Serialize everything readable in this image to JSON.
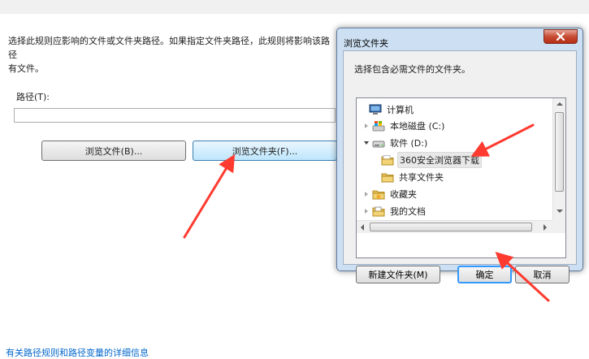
{
  "background_panel": {
    "description": "选择此规则应影响的文件或文件夹路径。如果指定文件夹路径，此规则将影响该路径\n有文件。",
    "path_label": "路径(T):",
    "path_value": "",
    "browse_file_label": "浏览文件(B)...",
    "browse_folder_label": "浏览文件夹(F)...",
    "help_link": "有关路径规则和路径变量的详细信息"
  },
  "dialog": {
    "title": "浏览文件夹",
    "prompt": "选择包含必需文件的文件夹。",
    "close_icon": "close-x-icon",
    "tree": [
      {
        "label": "计算机",
        "icon": "computer-icon",
        "expander": "none",
        "level": 0
      },
      {
        "label": "本地磁盘 (C:)",
        "icon": "windows-drive-icon",
        "expander": "closed",
        "level": 1
      },
      {
        "label": "软件 (D:)",
        "icon": "drive-icon",
        "expander": "open",
        "level": 1
      },
      {
        "label": "360安全浏览器下载",
        "icon": "folder-icon",
        "expander": "none",
        "level": 2,
        "selected": true
      },
      {
        "label": "共享文件夹",
        "icon": "folder-icon",
        "expander": "none",
        "level": 2
      },
      {
        "label": "收藏夹",
        "icon": "favorites-folder-icon",
        "expander": "closed",
        "level": 1
      },
      {
        "label": "我的文档",
        "icon": "documents-folder-icon",
        "expander": "closed",
        "level": 1
      }
    ],
    "new_folder_label": "新建文件夹(M)",
    "ok_label": "确定",
    "cancel_label": "取消"
  },
  "colors": {
    "dialog_frame": "#cde0f3",
    "close_button": "#c74d35",
    "annotation_arrow": "#ff3b30",
    "link": "#0066cc"
  }
}
